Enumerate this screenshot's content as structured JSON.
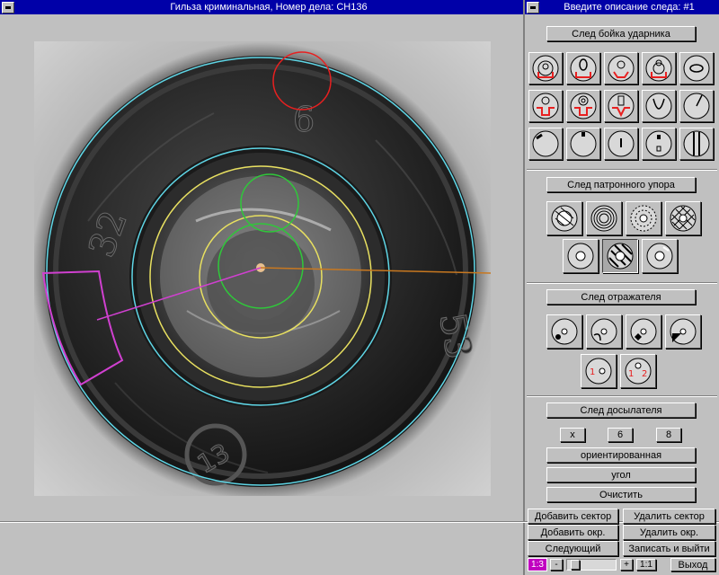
{
  "window": {
    "title": "Гильза криминальная,  Номер дела: CH136"
  },
  "side": {
    "title": "Введите описание следа: #1",
    "sections": {
      "firing_pin": "След бойка ударника",
      "breech_face": "След патронного упора",
      "ejector": "След отражателя",
      "chamber": "След досылателя"
    },
    "chamber_buttons": [
      "x",
      "6",
      "8"
    ],
    "oriented_label": "ориентированная",
    "angle_label": "угол",
    "clear_label": "Очистить"
  },
  "bottom": {
    "add_sector": "Добавить сектор",
    "delete_sector": "Удалить сектор",
    "add_circle": "Добавить окр.",
    "delete_circle": "Удалить окр.",
    "next": "Следующий",
    "save_exit": "Записать и выйти",
    "zoom_value": "1:3",
    "zoom_minus": "-",
    "zoom_plus": "+",
    "zoom_reset": "1:1",
    "exit": "Выход"
  },
  "image": {
    "stamp_top": "6",
    "stamp_left": "32",
    "stamp_right": "53",
    "stamp_bottom": "13"
  },
  "colors": {
    "title_bg": "#0000a8",
    "outer_circle": "#5fd6e6",
    "primer_circle": "#e8e060",
    "pin_circle": "#2fc83a",
    "mark_red": "#e82020",
    "sector": "#d040d0",
    "axis": "#c87820",
    "zoom_badge": "#c000c0"
  }
}
